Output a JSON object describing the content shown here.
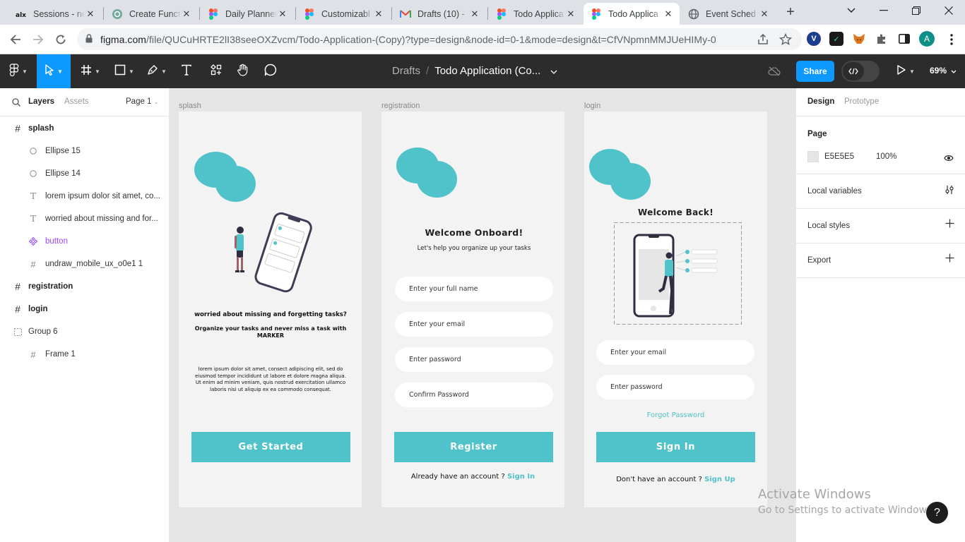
{
  "browser": {
    "tabs": [
      {
        "title": "Sessions - ne",
        "icon": "alx-icon"
      },
      {
        "title": "Create Funct",
        "icon": "chatgpt-icon"
      },
      {
        "title": "Daily Planner",
        "icon": "figma-icon"
      },
      {
        "title": "Customizabl",
        "icon": "figma-icon"
      },
      {
        "title": "Drafts (10) -",
        "icon": "gmail-icon"
      },
      {
        "title": "Todo Applica",
        "icon": "figma-icon"
      },
      {
        "title": "Todo Applica",
        "icon": "figma-icon",
        "active": true
      },
      {
        "title": "Event Sched",
        "icon": "globe-icon"
      }
    ],
    "url_host": "figma.com",
    "url_rest": "/file/QUCuHRTE2lI38seeOXZvcm/Todo-Application-(Copy)?type=design&node-id=0-1&mode=design&t=CfVNpmnMMJUeHIMy-0",
    "profile_initial": "A"
  },
  "toolbar": {
    "breadcrumb_parent": "Drafts",
    "breadcrumb_sep": "/",
    "file_title": "Todo Application (Co...",
    "share_label": "Share",
    "zoom": "69%"
  },
  "left_panel": {
    "tab_layers": "Layers",
    "tab_assets": "Assets",
    "page_select": "Page 1",
    "layers": [
      {
        "name": "splash",
        "type": "frame",
        "depth": 0
      },
      {
        "name": "Ellipse 15",
        "type": "ellipse",
        "depth": 1
      },
      {
        "name": "Ellipse 14",
        "type": "ellipse",
        "depth": 1
      },
      {
        "name": "lorem ipsum dolor sit amet, co...",
        "type": "text",
        "depth": 1
      },
      {
        "name": "worried about missing and for...",
        "type": "text",
        "depth": 1
      },
      {
        "name": "button",
        "type": "component",
        "depth": 1
      },
      {
        "name": "undraw_mobile_ux_o0e1 1",
        "type": "frame",
        "depth": 1
      },
      {
        "name": "registration",
        "type": "frame",
        "depth": 0
      },
      {
        "name": "login",
        "type": "frame",
        "depth": 0
      },
      {
        "name": "Group 6",
        "type": "group",
        "depth": 0
      },
      {
        "name": "Frame 1",
        "type": "frame",
        "depth": 1
      }
    ]
  },
  "canvas": {
    "splash": {
      "label": "splash",
      "headline": "worried about missing and forgetting tasks?",
      "subhead": "Organize your tasks and never miss a task with MARKER",
      "body": "lorem ipsum dolor sit amet, consect adipiscing elit, sed do eiusmod tempor incididunt ut labore et dolore magna aliqua. Ut enim ad minim veniam, quis nostrud exercitation ullamco laboris nisi ut aliquip ex ea commodo consequat.",
      "button": "Get Started"
    },
    "registration": {
      "label": "registration",
      "title": "Welcome Onboard!",
      "subtitle": "Let's help you organize up your tasks",
      "fields": [
        "Enter your full name",
        "Enter your email",
        "Enter password",
        "Confirm Password"
      ],
      "button": "Register",
      "footer_text": "Already have an account ?",
      "footer_link": "Sign In"
    },
    "login": {
      "label": "login",
      "title": "Welcome Back!",
      "fields": [
        "Enter your email",
        "Enter password"
      ],
      "forgot": "Forgot Password",
      "button": "Sign In",
      "footer_text": "Don't have an account ?",
      "footer_link": "Sign Up"
    },
    "accent_color": "#50C2C9"
  },
  "right_panel": {
    "tab_design": "Design",
    "tab_prototype": "Prototype",
    "page_heading": "Page",
    "page_color": "E5E5E5",
    "page_opacity": "100%",
    "local_variables": "Local variables",
    "local_styles": "Local styles",
    "export": "Export"
  },
  "watermark": {
    "line1": "Activate Windows",
    "line2": "Go to Settings to activate Windows."
  }
}
